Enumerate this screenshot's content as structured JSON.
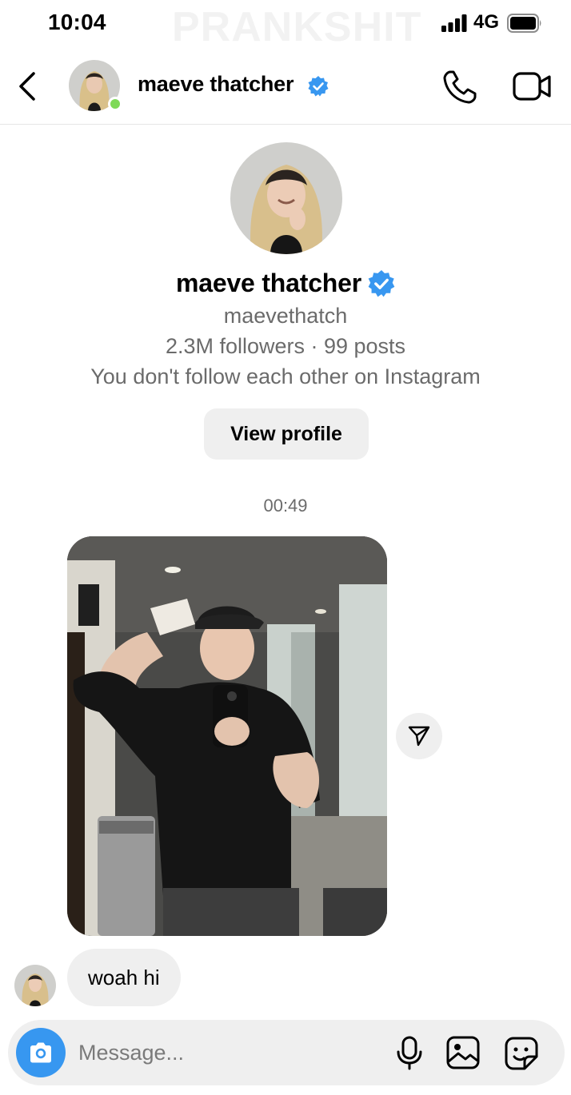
{
  "status_bar": {
    "time": "10:04",
    "watermark": "PRANKSHIT",
    "network": "4G",
    "signal_bars": 4,
    "battery_level": 0.9
  },
  "header": {
    "name": "maeve thatcher",
    "verified": true,
    "online": true,
    "icons": {
      "back": "chevron-left-icon",
      "call": "phone-icon",
      "video": "video-camera-icon",
      "verified": "verified-badge-icon"
    }
  },
  "profile": {
    "name": "maeve thatcher",
    "username": "maevethatch",
    "stats": "2.3M followers · 99 posts",
    "follow_status": "You don't follow each other on Instagram",
    "view_profile_label": "View profile"
  },
  "conversation": {
    "timestamp": "00:49",
    "messages": [
      {
        "type": "photo",
        "sender": "maeve thatcher",
        "description_icon": "mirror-selfie-photo"
      },
      {
        "type": "text",
        "sender": "maeve thatcher",
        "text": "woah hi"
      }
    ]
  },
  "composer": {
    "placeholder": "Message...",
    "icons": {
      "camera": "camera-icon",
      "mic": "microphone-icon",
      "gallery": "gallery-icon",
      "sticker": "sticker-icon"
    }
  },
  "colors": {
    "accent": "#3797f0",
    "verified": "#3897f0",
    "online": "#7ed957",
    "bubble": "#efefef",
    "secondary_text": "#6b6b6b"
  }
}
